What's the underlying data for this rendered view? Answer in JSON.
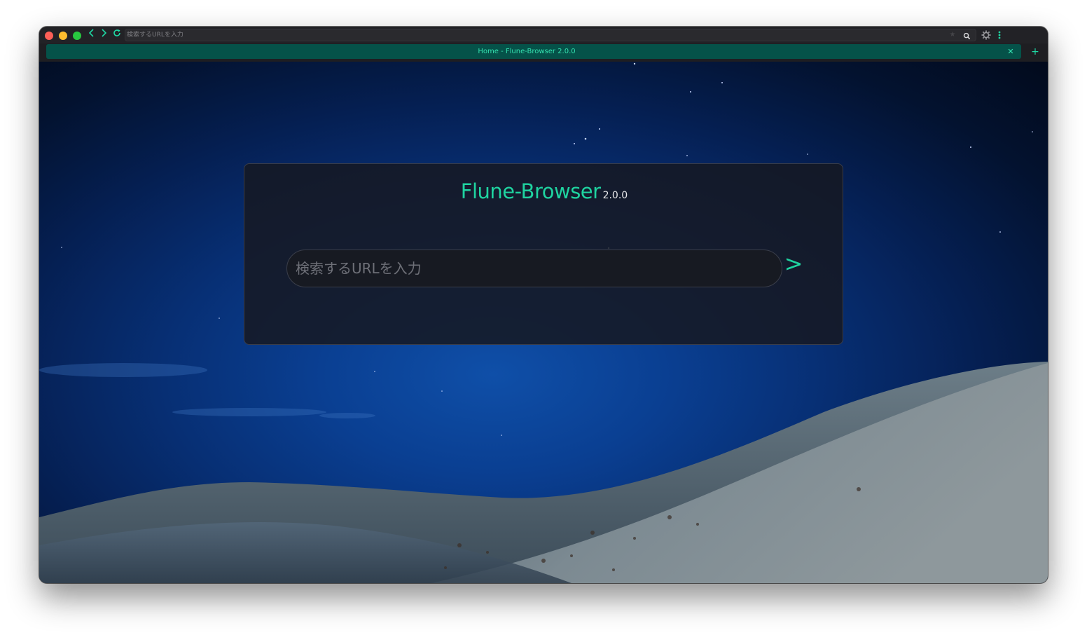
{
  "window": {
    "url_placeholder": "検索するURLを入力"
  },
  "toolbar": {
    "back_glyph": "‹",
    "forward_glyph": "›",
    "reload_glyph": "↻",
    "bookmark_glyph": "★",
    "icons": [
      "chevron-left-icon",
      "chevron-right-icon",
      "reload-icon",
      "star-icon",
      "zoom-icon",
      "gear-icon",
      "more-vertical-icon"
    ]
  },
  "tabs": [
    {
      "title": "Home - Flune-Browser 2.0.0",
      "active": true,
      "close_glyph": "✕"
    }
  ],
  "new_tab_glyph": "+",
  "home": {
    "brand_name": "Flune-Browser",
    "version": "2.0.0",
    "search_placeholder": "検索するURLを入力",
    "go_label": ">"
  },
  "colors": {
    "accent": "#1fd3a0",
    "tab_background": "#055249",
    "chrome_background": "#222226",
    "card_background": "#161822",
    "traffic_close": "#fe5f57",
    "traffic_minimize": "#febc2e",
    "traffic_maximize": "#28c840"
  }
}
